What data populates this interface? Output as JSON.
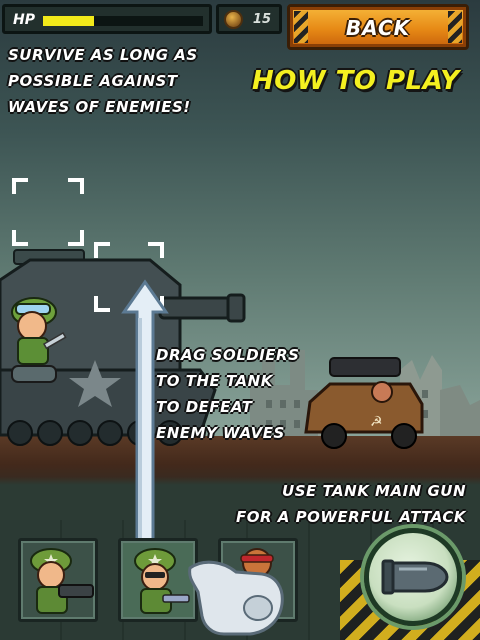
{
  "hud": {
    "hp_label": "HP",
    "hp_fraction": 0.32,
    "coin_count": "15",
    "back_label": "BACK"
  },
  "intro": {
    "lines": [
      "SURVIVE AS LONG AS",
      "POSSIBLE AGAINST",
      "WAVES OF ENEMIES!"
    ]
  },
  "title": "HOW TO PLAY",
  "instructions": {
    "drag_lines": [
      "DRAG SOLDIERS",
      "TO THE TANK",
      "TO DEFEAT",
      "ENEMY WAVES"
    ],
    "gun_lines": [
      "USE TANK MAIN GUN",
      "FOR A POWERFUL ATTACK"
    ]
  },
  "colors": {
    "accent_yellow": "#f4f020",
    "hp_bar": "#f2ea1a",
    "back_button": "#e78a16"
  },
  "icons": {
    "coin": "coin-icon",
    "hand": "pointing-hand-icon",
    "shell": "tank-shell-icon",
    "arrow": "drag-arrow-icon"
  },
  "soldier_cards": [
    {
      "name": "bazooka-soldier-card"
    },
    {
      "name": "gunner-soldier-card"
    },
    {
      "name": "bandana-soldier-card"
    }
  ]
}
